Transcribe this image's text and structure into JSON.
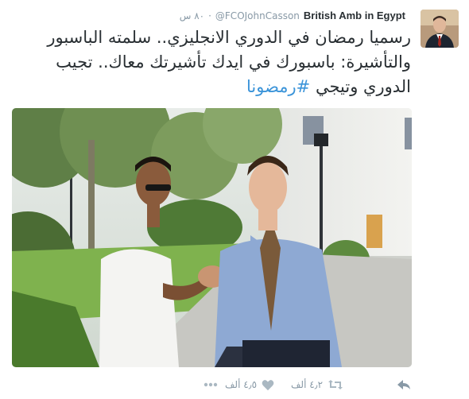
{
  "tweet": {
    "name": "British Amb in Egypt",
    "handle": "@FCOJohnCasson",
    "time": "٨٠ س",
    "text_before": "رسميا رمضان في الدوري الانجليزي.. سلمته الباسبور والتأشيرة: باسبورك في ايدك تأشيرتك معاك.. تجيب الدوري وتيجي ",
    "hashtag": "#رمضونا",
    "retweets": "٤٫٢ ألف",
    "likes": "٤٫٥ ألف"
  },
  "icons": {
    "reply": "reply-icon",
    "retweet": "retweet-icon",
    "like": "heart-icon",
    "more": "more-icon"
  },
  "colors": {
    "text": "#292f33",
    "muted": "#8899a6",
    "link": "#3b94d9"
  }
}
